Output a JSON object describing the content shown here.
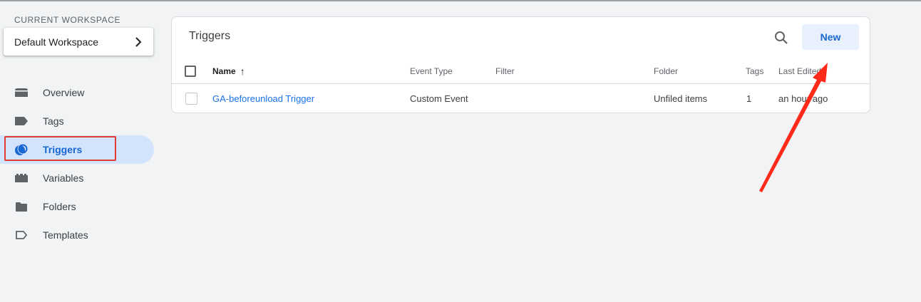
{
  "workspace": {
    "label": "CURRENT WORKSPACE",
    "name": "Default Workspace"
  },
  "sidebar": {
    "items": [
      {
        "label": "Overview",
        "icon": "overview-icon"
      },
      {
        "label": "Tags",
        "icon": "tag-icon"
      },
      {
        "label": "Triggers",
        "icon": "trigger-icon",
        "active": true
      },
      {
        "label": "Variables",
        "icon": "variables-icon"
      },
      {
        "label": "Folders",
        "icon": "folder-icon"
      },
      {
        "label": "Templates",
        "icon": "template-icon"
      }
    ]
  },
  "main": {
    "title": "Triggers",
    "new_label": "New",
    "columns": [
      "Name",
      "Event Type",
      "Filter",
      "Folder",
      "Tags",
      "Last Edited"
    ],
    "sort_indicator": "↑",
    "rows": [
      {
        "name": "GA-beforeunload Trigger",
        "event_type": "Custom Event",
        "filter": "",
        "folder": "Unfiled items",
        "tags": "1",
        "last_edited": "an hour ago"
      }
    ]
  },
  "colors": {
    "accent": "#1967d2",
    "active_bg": "#d2e3fc",
    "annotation": "#e53935"
  }
}
